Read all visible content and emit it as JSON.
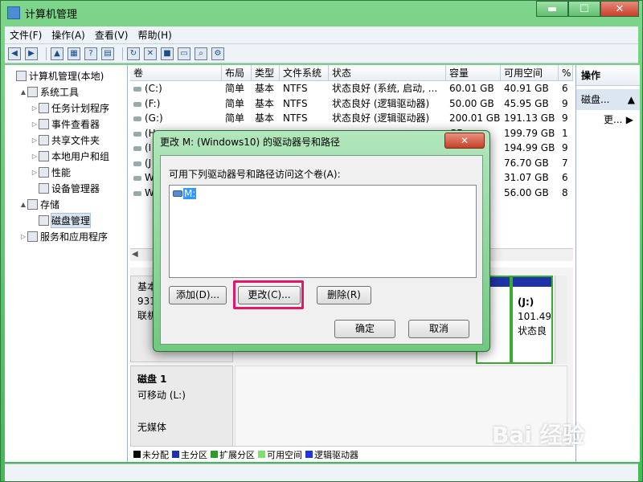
{
  "window": {
    "title": "计算机管理"
  },
  "menu": [
    "文件(F)",
    "操作(A)",
    "查看(V)",
    "帮助(H)"
  ],
  "tree": [
    {
      "label": "计算机管理(本地)",
      "level": 0,
      "arrow": ""
    },
    {
      "label": "系统工具",
      "level": 1,
      "arrow": "▲"
    },
    {
      "label": "任务计划程序",
      "level": 2,
      "arrow": "▷"
    },
    {
      "label": "事件查看器",
      "level": 2,
      "arrow": "▷"
    },
    {
      "label": "共享文件夹",
      "level": 2,
      "arrow": "▷"
    },
    {
      "label": "本地用户和组",
      "level": 2,
      "arrow": "▷"
    },
    {
      "label": "性能",
      "level": 2,
      "arrow": "▷"
    },
    {
      "label": "设备管理器",
      "level": 2,
      "arrow": ""
    },
    {
      "label": "存储",
      "level": 1,
      "arrow": "▲"
    },
    {
      "label": "磁盘管理",
      "level": 2,
      "arrow": "",
      "selected": true
    },
    {
      "label": "服务和应用程序",
      "level": 1,
      "arrow": "▷"
    }
  ],
  "volume_columns": [
    "卷",
    "布局",
    "类型",
    "文件系统",
    "状态",
    "容量",
    "可用空间",
    "%"
  ],
  "volume_rows": [
    [
      "(C:)",
      "简单",
      "基本",
      "NTFS",
      "状态良好 (系统, 启动, ...",
      "60.01 GB",
      "40.91 GB",
      "6"
    ],
    [
      "(F:)",
      "简单",
      "基本",
      "NTFS",
      "状态良好 (逻辑驱动器)",
      "50.00 GB",
      "45.95 GB",
      "9"
    ],
    [
      "(G:)",
      "简单",
      "基本",
      "NTFS",
      "状态良好 (逻辑驱动器)",
      "200.01 GB",
      "191.13 GB",
      "9"
    ],
    [
      "(H",
      "",
      "",
      "",
      "",
      "GB",
      "199.79 GB",
      "1"
    ],
    [
      "(I",
      "",
      "",
      "",
      "",
      "GB",
      "194.99 GB",
      "9"
    ],
    [
      "(J",
      "",
      "",
      "",
      "",
      "GB",
      "76.70 GB",
      "7"
    ],
    [
      "W",
      "",
      "",
      "",
      "",
      "GB",
      "31.07 GB",
      "6"
    ],
    [
      "W",
      "",
      "",
      "",
      "",
      "GB",
      "56.00 GB",
      "8"
    ]
  ],
  "disk0": {
    "line1": "基本",
    "line2": "931",
    "line3": "联机"
  },
  "partitions": [
    {
      "l1": ")",
      "l2": "00",
      "l3": "良"
    },
    {
      "l1": "(J:)",
      "l2": "101.49",
      "l3": "状态良"
    }
  ],
  "disk1": {
    "name": "磁盘 1",
    "type": "可移动 (L:)",
    "media": "无媒体"
  },
  "legend": [
    {
      "label": "未分配",
      "color": "#000000"
    },
    {
      "label": "主分区",
      "color": "#1f33a8"
    },
    {
      "label": "扩展分区",
      "color": "#2e9a2e"
    },
    {
      "label": "可用空间",
      "color": "#7ee06c"
    },
    {
      "label": "逻辑驱动器",
      "color": "#2136d9"
    }
  ],
  "actions": {
    "header": "操作",
    "sub": "磁盘...",
    "more": "更..."
  },
  "dialog": {
    "title": "更改 M: (Windows10) 的驱动器号和路径",
    "label": "可用下列驱动器号和路径访问这个卷(A):",
    "item": "M:",
    "add": "添加(D)...",
    "change": "更改(C)...",
    "delete": "删除(R)",
    "ok": "确定",
    "cancel": "取消"
  },
  "watermark": {
    "main": "Bai 经验",
    "sub": "jingyan.baidu.com"
  }
}
